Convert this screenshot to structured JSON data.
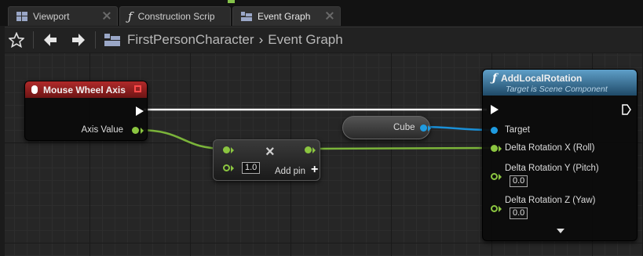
{
  "tabs": [
    {
      "label": "Viewport",
      "icon": "viewport-grid-icon"
    },
    {
      "label": "Construction Scrip",
      "icon": "function-icon"
    },
    {
      "label": "Event Graph",
      "icon": "event-graph-icon"
    }
  ],
  "breadcrumb": {
    "blueprint": "FirstPersonCharacter",
    "separator": "›",
    "graph": "Event Graph"
  },
  "nodes": {
    "mouse_wheel": {
      "title": "Mouse Wheel Axis",
      "output_label": "Axis Value",
      "header_color": "#8b1c1c"
    },
    "multiply": {
      "value": "1.0",
      "add_pin_label": "Add pin",
      "symbol": "×"
    },
    "cube": {
      "label": "Cube"
    },
    "add_local_rotation": {
      "title": "AddLocalRotation",
      "subtitle": "Target is Scene Component",
      "header_color": "#3f7fa8",
      "target_label": "Target",
      "rot_x_label": "Delta Rotation X (Roll)",
      "rot_y_label": "Delta Rotation Y (Pitch)",
      "rot_y_value": "0.0",
      "rot_z_label": "Delta Rotation Z (Yaw)",
      "rot_z_value": "0.0"
    }
  },
  "colors": {
    "float_pin": "#8bc540",
    "object_pin": "#1f9be0",
    "exec_pin": "#ffffff",
    "tab_accent": "#85c34a"
  }
}
